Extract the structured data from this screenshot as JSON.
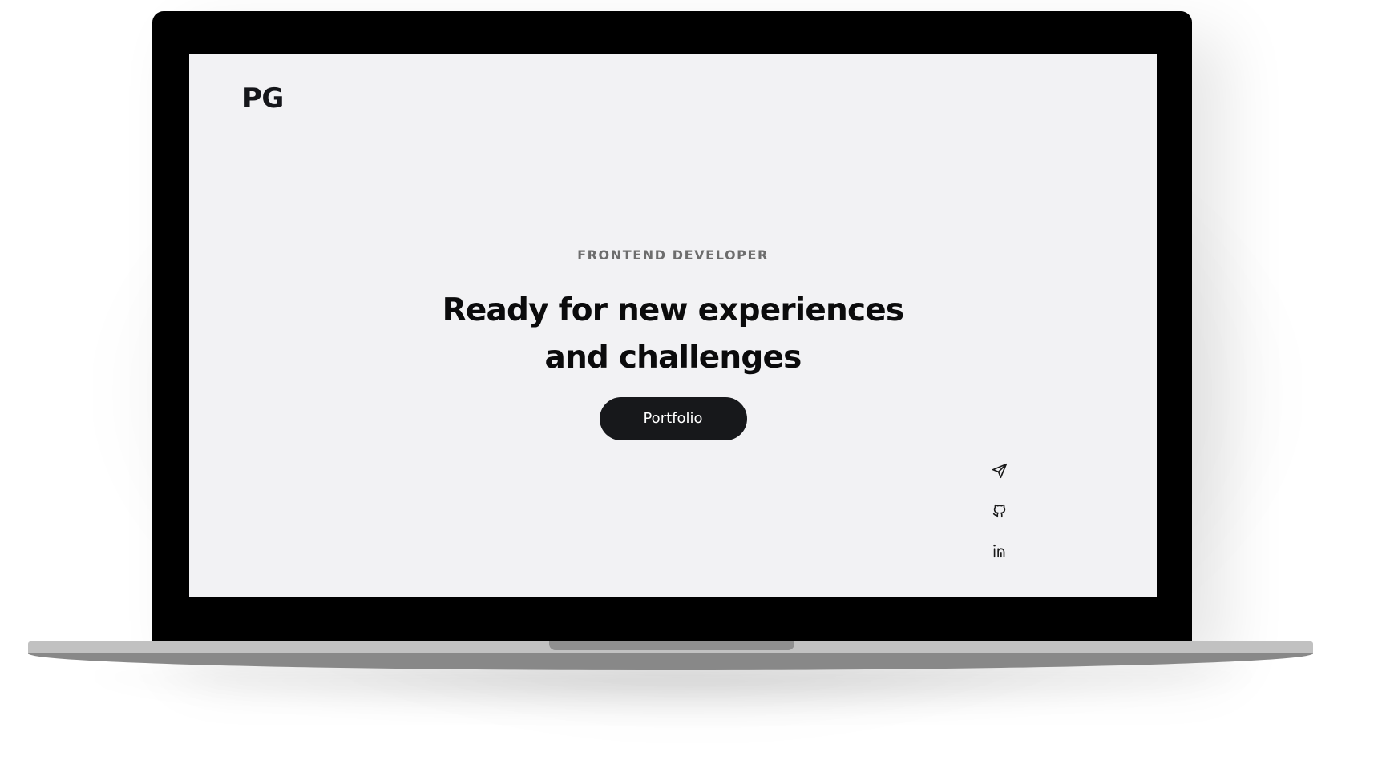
{
  "site": {
    "logo": "PG",
    "hero": {
      "subtitle": "FRONTEND DEVELOPER",
      "headline": "Ready for new experiences and challenges",
      "cta_label": "Portfolio"
    },
    "socials": [
      {
        "icon": "send-icon"
      },
      {
        "icon": "github-icon"
      },
      {
        "icon": "linkedin-icon"
      }
    ]
  },
  "colors": {
    "screen_background": "#f2f2f4",
    "cta_background": "#17181b",
    "cta_text": "#ffffff",
    "headline_text": "#0b0b0c",
    "subtitle_text": "#6d6d6d",
    "bezel": "#000000",
    "laptop_base": "#c1c1c1"
  }
}
